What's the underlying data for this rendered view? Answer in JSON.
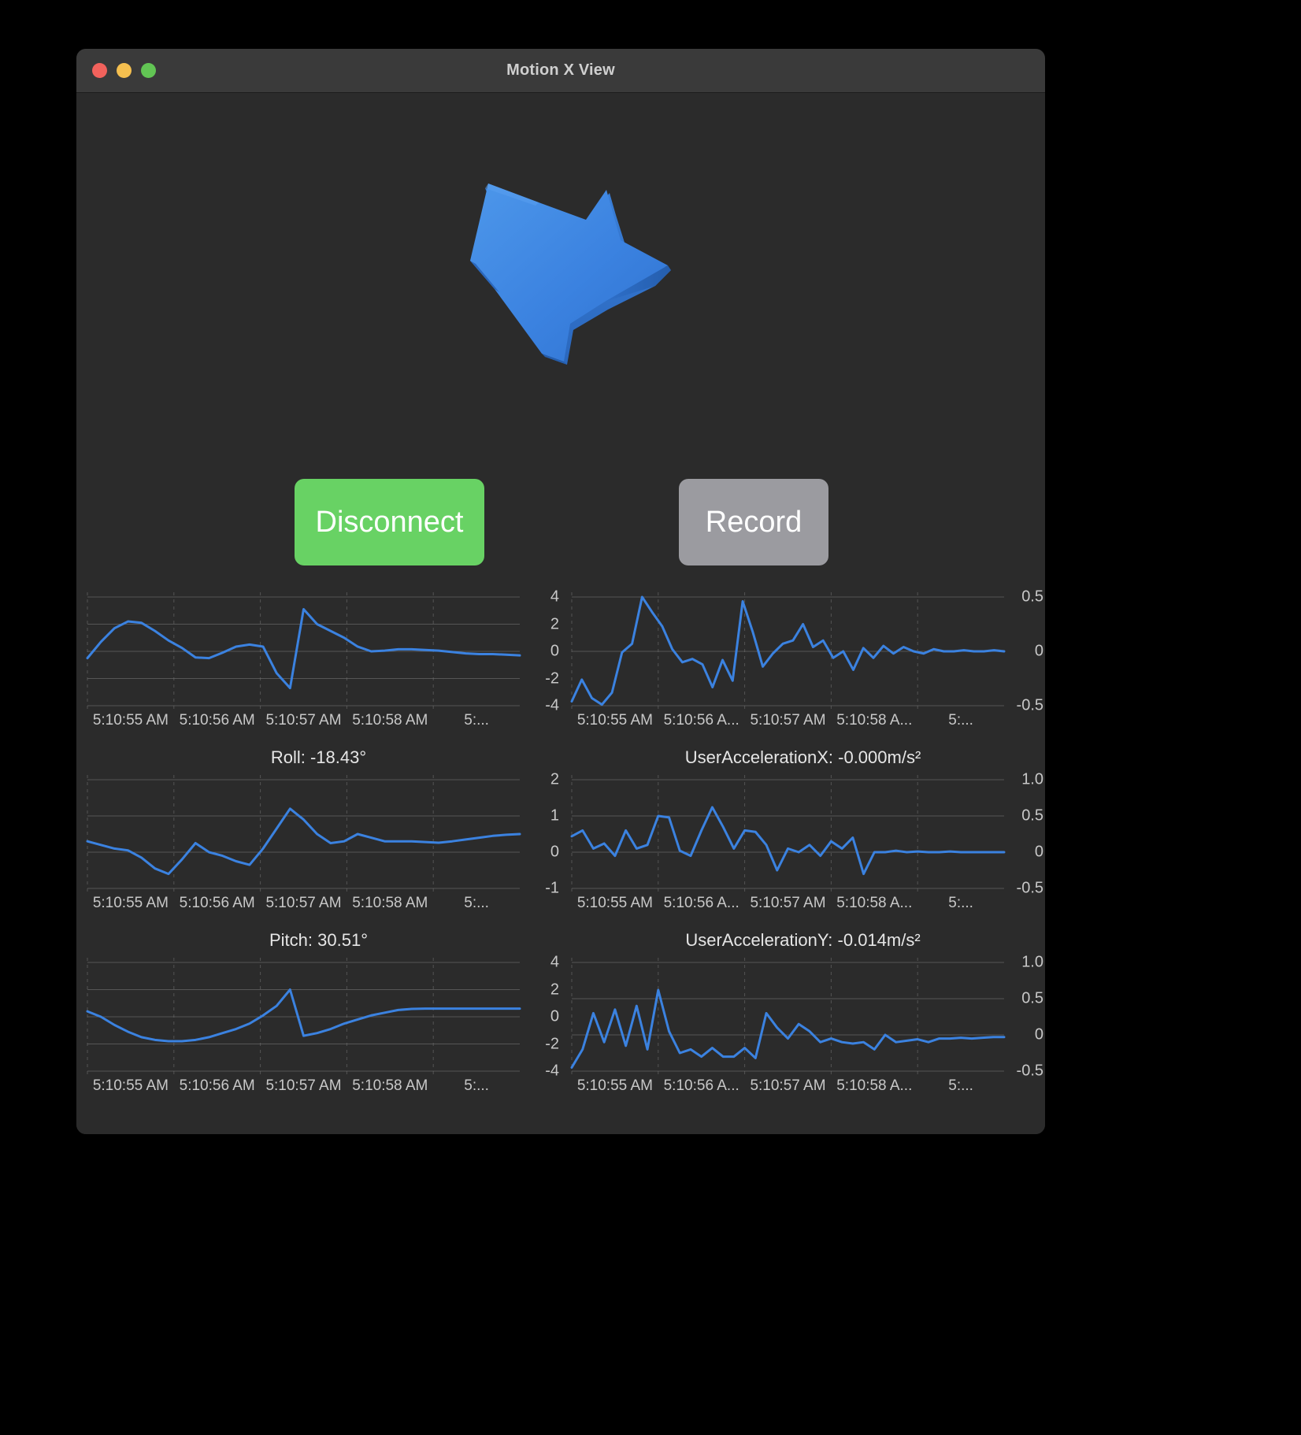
{
  "window": {
    "title": "Motion X View",
    "traffic_lights": [
      "close",
      "minimize",
      "zoom"
    ]
  },
  "arrow": {
    "color": "#3b82e0",
    "name": "3d-arrow-indicator"
  },
  "buttons": {
    "disconnect": {
      "label": "Disconnect",
      "color": "#68d264"
    },
    "record": {
      "label": "Record",
      "color": "#9b9ba0"
    }
  },
  "colors": {
    "background": "#2b2b2b",
    "titlebar": "#3a3a3a",
    "line": "#3b82e0",
    "grid": "#6e6e6e",
    "text": "#c8c8c8"
  },
  "chart_data": [
    {
      "id": "yaw",
      "type": "line",
      "title": "",
      "ylabel": "",
      "xlabel": "",
      "ylim": [
        -4,
        4
      ],
      "yticks": [
        4,
        2,
        0,
        -2,
        -4
      ],
      "ytick_labels": [
        "4",
        "2",
        "0",
        "-2",
        "-4"
      ],
      "xtick_labels": [
        "5:10:55 AM",
        "5:10:56 AM",
        "5:10:57 AM",
        "5:10:58 AM",
        "5:..."
      ],
      "grid": true,
      "legend": "none",
      "values": [
        -0.5,
        0.7,
        1.7,
        2.2,
        2.1,
        1.5,
        0.8,
        0.25,
        -0.45,
        -0.5,
        -0.1,
        0.35,
        0.5,
        0.35,
        -1.6,
        -2.7,
        3.1,
        2.0,
        1.5,
        1.0,
        0.35,
        0.0,
        0.05,
        0.15,
        0.15,
        0.1,
        0.05,
        -0.05,
        -0.15,
        -0.2,
        -0.2,
        -0.25,
        -0.3
      ]
    },
    {
      "id": "rotation_rate_x",
      "type": "line",
      "title": "",
      "ylabel": "",
      "xlabel": "",
      "ylim": [
        -0.5,
        0.5
      ],
      "yticks": [
        0.5,
        0,
        -0.5
      ],
      "ytick_labels": [
        "0.5",
        "0",
        "-0.5"
      ],
      "xtick_labels": [
        "5:10:55 AM",
        "5:10:56 A...",
        "5:10:57 AM",
        "5:10:58 A...",
        "5:..."
      ],
      "grid": true,
      "legend": "none",
      "values": [
        -0.46,
        -0.26,
        -0.43,
        -0.49,
        -0.38,
        -0.01,
        0.07,
        0.5,
        0.36,
        0.23,
        0.02,
        -0.1,
        -0.07,
        -0.12,
        -0.33,
        -0.08,
        -0.27,
        0.46,
        0.18,
        -0.14,
        -0.02,
        0.07,
        0.1,
        0.25,
        0.04,
        0.1,
        -0.06,
        0.0,
        -0.17,
        0.03,
        -0.06,
        0.05,
        -0.02,
        0.04,
        0.0,
        -0.02,
        0.02,
        0.0,
        0.0,
        0.01,
        0.0,
        0.0,
        0.01,
        0.0
      ]
    },
    {
      "id": "roll",
      "type": "line",
      "title": "Roll: -18.43°",
      "ylabel": "",
      "xlabel": "",
      "ylim": [
        -1,
        2
      ],
      "yticks": [
        2,
        1,
        0,
        -1
      ],
      "ytick_labels": [
        "2",
        "1",
        "0",
        "-1"
      ],
      "xtick_labels": [
        "5:10:55 AM",
        "5:10:56 AM",
        "5:10:57 AM",
        "5:10:58 AM",
        "5:..."
      ],
      "grid": true,
      "legend": "none",
      "values": [
        0.3,
        0.2,
        0.1,
        0.05,
        -0.15,
        -0.45,
        -0.6,
        -0.2,
        0.25,
        0.0,
        -0.1,
        -0.25,
        -0.35,
        0.1,
        0.65,
        1.2,
        0.9,
        0.5,
        0.25,
        0.3,
        0.5,
        0.4,
        0.3,
        0.3,
        0.3,
        0.28,
        0.26,
        0.3,
        0.35,
        0.4,
        0.45,
        0.48,
        0.5
      ]
    },
    {
      "id": "user_acceleration_x",
      "type": "line",
      "title": "UserAccelerationX: -0.000m/s²",
      "ylabel": "",
      "xlabel": "",
      "ylim": [
        -0.5,
        1.0
      ],
      "yticks": [
        1.0,
        0.5,
        0,
        -0.5
      ],
      "ytick_labels": [
        "1.0",
        "0.5",
        "0",
        "-0.5"
      ],
      "xtick_labels": [
        "5:10:55 AM",
        "5:10:56 A...",
        "5:10:57 AM",
        "5:10:58 A...",
        "5:..."
      ],
      "grid": true,
      "legend": "none",
      "values": [
        0.22,
        0.3,
        0.05,
        0.12,
        -0.05,
        0.3,
        0.05,
        0.1,
        0.5,
        0.48,
        0.02,
        -0.05,
        0.3,
        0.62,
        0.35,
        0.05,
        0.3,
        0.28,
        0.1,
        -0.25,
        0.05,
        0.0,
        0.1,
        -0.05,
        0.15,
        0.05,
        0.2,
        -0.3,
        0.0,
        0.0,
        0.02,
        0.0,
        0.01,
        0.0,
        0.0,
        0.01,
        0.0,
        0.0,
        0.0,
        0.0,
        0.0
      ]
    },
    {
      "id": "pitch",
      "type": "line",
      "title": "Pitch: 30.51°",
      "ylabel": "",
      "xlabel": "",
      "ylim": [
        -4,
        4
      ],
      "yticks": [
        4,
        2,
        0,
        -2,
        -4
      ],
      "ytick_labels": [
        "4",
        "2",
        "0",
        "-2",
        "-4"
      ],
      "xtick_labels": [
        "5:10:55 AM",
        "5:10:56 AM",
        "5:10:57 AM",
        "5:10:58 AM",
        "5:..."
      ],
      "grid": true,
      "legend": "none",
      "values": [
        0.4,
        0.0,
        -0.6,
        -1.1,
        -1.5,
        -1.7,
        -1.8,
        -1.8,
        -1.7,
        -1.5,
        -1.2,
        -0.9,
        -0.5,
        0.1,
        0.8,
        2.0,
        -1.4,
        -1.2,
        -0.9,
        -0.5,
        -0.2,
        0.1,
        0.3,
        0.5,
        0.58,
        0.6,
        0.6,
        0.6,
        0.6,
        0.6,
        0.6,
        0.6,
        0.6
      ]
    },
    {
      "id": "user_acceleration_y",
      "type": "line",
      "title": "UserAccelerationY: -0.014m/s²",
      "ylabel": "",
      "xlabel": "",
      "ylim": [
        -0.5,
        1.0
      ],
      "yticks": [
        1.0,
        0.5,
        0,
        -0.5
      ],
      "ytick_labels": [
        "1.0",
        "0.5",
        "0",
        "-0.5"
      ],
      "xtick_labels": [
        "5:10:55 AM",
        "5:10:56 A...",
        "5:10:57 AM",
        "5:10:58 A...",
        "5:..."
      ],
      "grid": true,
      "legend": "none",
      "values": [
        -0.45,
        -0.2,
        0.3,
        -0.1,
        0.35,
        -0.15,
        0.4,
        -0.2,
        0.62,
        0.05,
        -0.25,
        -0.2,
        -0.3,
        -0.18,
        -0.3,
        -0.3,
        -0.18,
        -0.32,
        0.3,
        0.1,
        -0.05,
        0.15,
        0.05,
        -0.1,
        -0.05,
        -0.1,
        -0.12,
        -0.1,
        -0.2,
        0.0,
        -0.1,
        -0.08,
        -0.06,
        -0.1,
        -0.05,
        -0.05,
        -0.04,
        -0.05,
        -0.04,
        -0.03,
        -0.03
      ]
    }
  ]
}
